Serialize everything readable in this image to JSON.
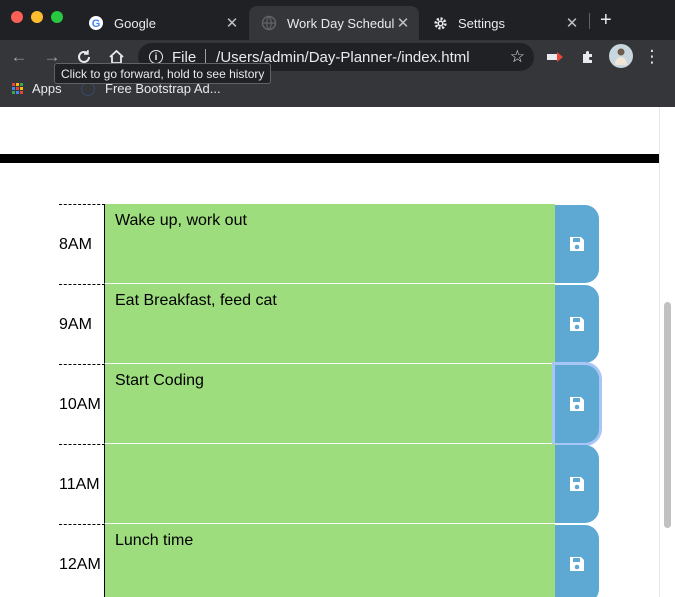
{
  "browser": {
    "tabs": [
      {
        "label": "Google",
        "icon": "google-icon"
      },
      {
        "label": "Work Day Schedul",
        "icon": "globe-icon"
      },
      {
        "label": "Settings",
        "icon": "gear-icon"
      }
    ],
    "address": {
      "security": "File",
      "url": "/Users/admin/Day-Planner-/index.html"
    },
    "tooltip": "Click to go forward, hold to see history",
    "bookmarks": [
      {
        "label": "Apps",
        "icon": "apps-grid-icon"
      },
      {
        "label": "Free Bootstrap Ad...",
        "icon": "bootstrap-icon"
      }
    ],
    "colors": {
      "frame": "#202124",
      "toolbar": "#35363a"
    }
  },
  "schedule": {
    "rows": [
      {
        "hour": "8AM",
        "text": "Wake up, work out"
      },
      {
        "hour": "9AM",
        "text": "Eat Breakfast, feed cat"
      },
      {
        "hour": "10AM",
        "text": "Start Coding"
      },
      {
        "hour": "11AM",
        "text": ""
      },
      {
        "hour": "12AM",
        "text": "Lunch time"
      }
    ],
    "colors": {
      "future": "#9ddd7e",
      "save": "#5ea8d4"
    }
  }
}
